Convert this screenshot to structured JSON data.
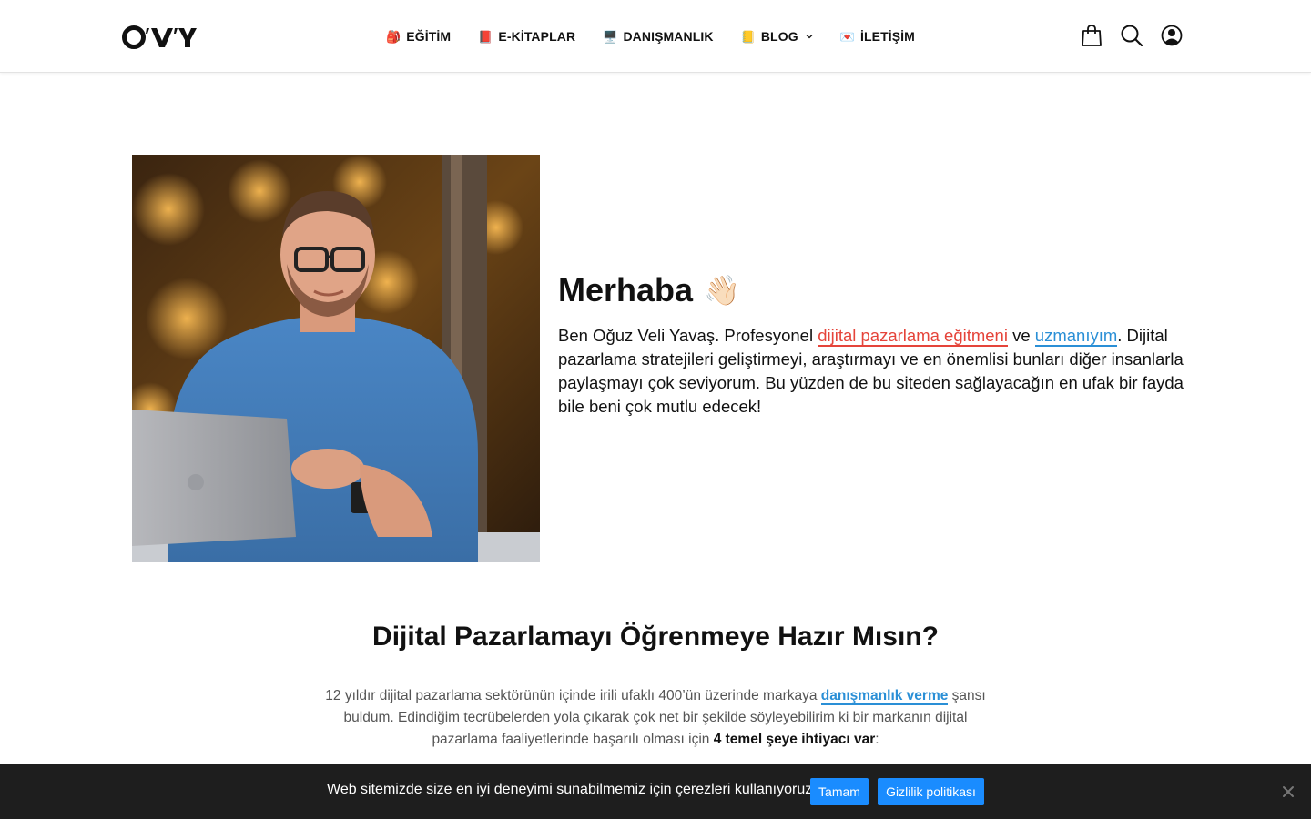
{
  "brand": {
    "logo_text": "OVY"
  },
  "nav": {
    "items": [
      {
        "emoji": "🎒",
        "label": "EĞİTİM"
      },
      {
        "emoji": "📕",
        "label": "E-KİTAPLAR"
      },
      {
        "emoji": "🖥️",
        "label": "DANIŞMANLIK"
      },
      {
        "emoji": "📒",
        "label": "BLOG"
      },
      {
        "emoji": "💌",
        "label": "İLETİŞİM"
      }
    ]
  },
  "header_icons": [
    "bag-icon",
    "search-icon",
    "user-icon"
  ],
  "hero": {
    "title": "Merhaba",
    "wave": "👋🏻",
    "p1": "Ben Oğuz Veli Yavaş. Profesyonel ",
    "link1": "dijital pazarlama eğitmeni",
    "p2": " ve ",
    "link2": "uzmanıyım",
    "p3": ". Dijital pazarlama stratejileri geliştirmeyi, araştırmayı ve en önemlisi bunları diğer insanlarla paylaşmayı çok seviyorum. Bu yüzden de bu siteden sağlayacağın en ufak bir fayda bile beni çok mutlu edecek!"
  },
  "section": {
    "title_light": "Dijital Pazarlamayı Öğrenmeye ",
    "title_bold": "Hazır Mısın?",
    "s1": "12 yıldır dijital pazarlama sektörünün içinde irili ufaklı 400’ün üzerinde markaya ",
    "link": "danışmanlık verme",
    "s2": " şansı buldum. Edindiğim tecrübelerden yola çıkarak çok net bir şekilde söyleyebilirim ki bir markanın dijital pazarlama faaliyetlerinde başarılı olması için ",
    "bold": "4 temel şeye ihtiyacı var",
    "s3": ":"
  },
  "cookie": {
    "text": "Web sitemizde size en iyi deneyimi sunabilmemiz için çerezleri kullanıyoruz.",
    "ok": "Tamam",
    "policy": "Gizlilik politikası"
  },
  "colors": {
    "accent_blue": "#2a8fd6",
    "accent_red": "#e5443a",
    "button_blue": "#1a8cff",
    "cookie_bg": "#1e1e1e"
  }
}
